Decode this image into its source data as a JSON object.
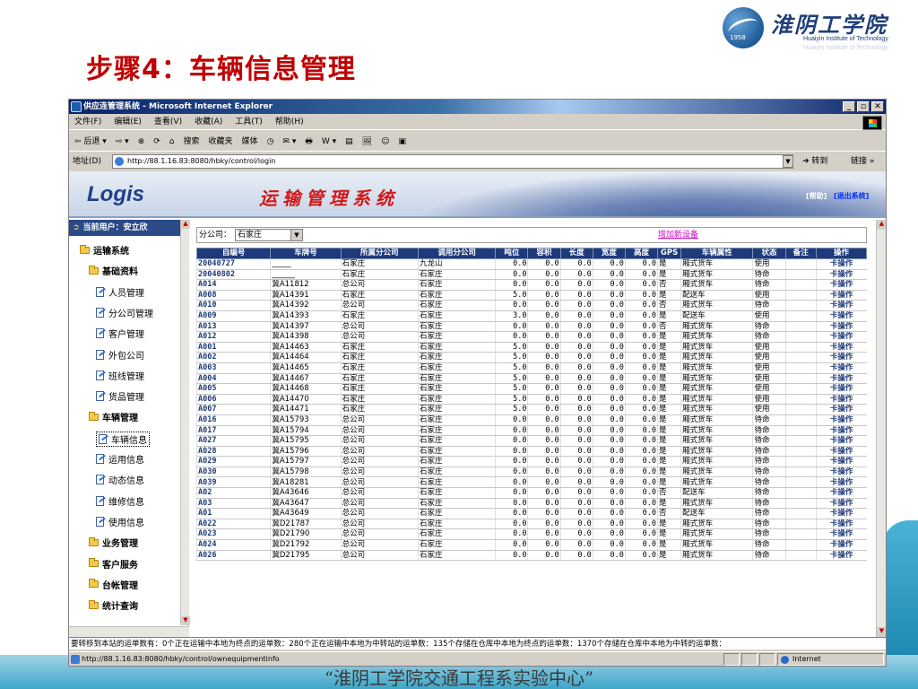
{
  "slide": {
    "title": "步骤4：车辆信息管理",
    "footer": "“淮阴工学院交通工程系实验中心”",
    "logo": {
      "cn": "淮阴工学院",
      "en": "Huaiyin Institute of Technology",
      "en_faded": "Huaiyin Institute of Technology",
      "year": "1958"
    }
  },
  "browser": {
    "title": "供应连管理系统 - Microsoft Internet Explorer",
    "menu": [
      "文件(F)",
      "编辑(E)",
      "查看(V)",
      "收藏(A)",
      "工具(T)",
      "帮助(H)"
    ],
    "toolbar": [
      "⇦ 后退 ▾",
      "⇨ ▾",
      "⊗",
      "⟳",
      "⌂",
      "搜索",
      "收藏夹",
      "媒体",
      "◷",
      "✉ ▾",
      "🖶",
      "W ▾",
      "▤",
      "🖼",
      "☺",
      "▣"
    ],
    "address_label": "地址(D)",
    "address": "http://88.1.16.83:8080/hbky/control/login",
    "go": "转到",
    "links": "链接 »",
    "status_url": "http://88.1.16.83:8080/hbky/control/ownequipmentinfo",
    "zone": "Internet"
  },
  "app": {
    "logo": "Logis",
    "title": "运输管理系统",
    "help": "[帮助]",
    "logout": "[退出系统]",
    "current_user": "当前用户：安立欣",
    "tree": [
      {
        "label": "运输系统",
        "type": "folder",
        "level": 0
      },
      {
        "label": "基础资料",
        "type": "folder",
        "level": 1
      },
      {
        "label": "人员管理",
        "type": "doc",
        "level": 2
      },
      {
        "label": "分公司管理",
        "type": "doc",
        "level": 2
      },
      {
        "label": "客户管理",
        "type": "doc",
        "level": 2
      },
      {
        "label": "外包公司",
        "type": "doc",
        "level": 2
      },
      {
        "label": "班线管理",
        "type": "doc",
        "level": 2
      },
      {
        "label": "货品管理",
        "type": "doc",
        "level": 2
      },
      {
        "label": "车辆管理",
        "type": "folder",
        "level": 1
      },
      {
        "label": "车辆信息",
        "type": "doc",
        "level": 2,
        "selected": true
      },
      {
        "label": "运用信息",
        "type": "doc",
        "level": 2
      },
      {
        "label": "动态信息",
        "type": "doc",
        "level": 2
      },
      {
        "label": "维修信息",
        "type": "doc",
        "level": 2
      },
      {
        "label": "使用信息",
        "type": "doc",
        "level": 2
      },
      {
        "label": "业务管理",
        "type": "folder",
        "level": 1
      },
      {
        "label": "客户服务",
        "type": "folder",
        "level": 1
      },
      {
        "label": "台帐管理",
        "type": "folder",
        "level": 1
      },
      {
        "label": "统计查询",
        "type": "folder",
        "level": 1
      }
    ],
    "filter_label": "分公司：",
    "filter_value": "石家庄",
    "add_link": "增加新设备",
    "columns": [
      "自编号",
      "车牌号",
      "所属分公司",
      "调用分公司",
      "吨位",
      "容积",
      "长度",
      "宽度",
      "高度",
      "GPS",
      "车辆属性",
      "状态",
      "备注",
      "操作"
    ],
    "rows": [
      [
        "20040727",
        "_____",
        "石家庄",
        "九龙山",
        "0.0",
        "0.0",
        "0.0",
        "0.0",
        "0.0",
        "是",
        "厢式货车",
        "使用",
        "",
        "卡操作"
      ],
      [
        "20040802",
        "______",
        "石家庄",
        "石家庄",
        "0.0",
        "0.0",
        "0.0",
        "0.0",
        "0.0",
        "是",
        "厢式货车",
        "待命",
        "",
        "卡操作"
      ],
      [
        "A014",
        "冀A11812",
        "总公司",
        "石家庄",
        "0.0",
        "0.0",
        "0.0",
        "0.0",
        "0.0",
        "否",
        "厢式货车",
        "待命",
        "",
        "卡操作"
      ],
      [
        "A008",
        "冀A14391",
        "石家庄",
        "石家庄",
        "5.0",
        "0.0",
        "0.0",
        "0.0",
        "0.0",
        "是",
        "配送车",
        "使用",
        "",
        "卡操作"
      ],
      [
        "A010",
        "冀A14392",
        "总公司",
        "石家庄",
        "0.0",
        "0.0",
        "0.0",
        "0.0",
        "0.0",
        "否",
        "厢式货车",
        "待命",
        "",
        "卡操作"
      ],
      [
        "A009",
        "冀A14393",
        "石家庄",
        "石家庄",
        "3.0",
        "0.0",
        "0.0",
        "0.0",
        "0.0",
        "是",
        "配送车",
        "使用",
        "",
        "卡操作"
      ],
      [
        "A013",
        "冀A14397",
        "总公司",
        "石家庄",
        "0.0",
        "0.0",
        "0.0",
        "0.0",
        "0.0",
        "否",
        "厢式货车",
        "待命",
        "",
        "卡操作"
      ],
      [
        "A012",
        "冀A14398",
        "总公司",
        "石家庄",
        "0.0",
        "0.0",
        "0.0",
        "0.0",
        "0.0",
        "是",
        "厢式货车",
        "待命",
        "",
        "卡操作"
      ],
      [
        "A001",
        "冀A14463",
        "石家庄",
        "石家庄",
        "5.0",
        "0.0",
        "0.0",
        "0.0",
        "0.0",
        "是",
        "厢式货车",
        "使用",
        "",
        "卡操作"
      ],
      [
        "A002",
        "冀A14464",
        "石家庄",
        "石家庄",
        "5.0",
        "0.0",
        "0.0",
        "0.0",
        "0.0",
        "是",
        "厢式货车",
        "使用",
        "",
        "卡操作"
      ],
      [
        "A003",
        "冀A14465",
        "石家庄",
        "石家庄",
        "5.0",
        "0.0",
        "0.0",
        "0.0",
        "0.0",
        "是",
        "厢式货车",
        "使用",
        "",
        "卡操作"
      ],
      [
        "A004",
        "冀A14467",
        "石家庄",
        "石家庄",
        "5.0",
        "0.0",
        "0.0",
        "0.0",
        "0.0",
        "是",
        "厢式货车",
        "使用",
        "",
        "卡操作"
      ],
      [
        "A005",
        "冀A14468",
        "石家庄",
        "石家庄",
        "5.0",
        "0.0",
        "0.0",
        "0.0",
        "0.0",
        "是",
        "厢式货车",
        "使用",
        "",
        "卡操作"
      ],
      [
        "A006",
        "冀A14470",
        "石家庄",
        "石家庄",
        "5.0",
        "0.0",
        "0.0",
        "0.0",
        "0.0",
        "是",
        "厢式货车",
        "使用",
        "",
        "卡操作"
      ],
      [
        "A007",
        "冀A14471",
        "石家庄",
        "石家庄",
        "5.0",
        "0.0",
        "0.0",
        "0.0",
        "0.0",
        "是",
        "厢式货车",
        "使用",
        "",
        "卡操作"
      ],
      [
        "A016",
        "冀A15793",
        "总公司",
        "石家庄",
        "0.0",
        "0.0",
        "0.0",
        "0.0",
        "0.0",
        "是",
        "厢式货车",
        "待命",
        "",
        "卡操作"
      ],
      [
        "A017",
        "冀A15794",
        "总公司",
        "石家庄",
        "0.0",
        "0.0",
        "0.0",
        "0.0",
        "0.0",
        "是",
        "厢式货车",
        "待命",
        "",
        "卡操作"
      ],
      [
        "A027",
        "冀A15795",
        "总公司",
        "石家庄",
        "0.0",
        "0.0",
        "0.0",
        "0.0",
        "0.0",
        "是",
        "厢式货车",
        "待命",
        "",
        "卡操作"
      ],
      [
        "A028",
        "冀A15796",
        "总公司",
        "石家庄",
        "0.0",
        "0.0",
        "0.0",
        "0.0",
        "0.0",
        "是",
        "厢式货车",
        "待命",
        "",
        "卡操作"
      ],
      [
        "A029",
        "冀A15797",
        "总公司",
        "石家庄",
        "0.0",
        "0.0",
        "0.0",
        "0.0",
        "0.0",
        "是",
        "厢式货车",
        "待命",
        "",
        "卡操作"
      ],
      [
        "A030",
        "冀A15798",
        "总公司",
        "石家庄",
        "0.0",
        "0.0",
        "0.0",
        "0.0",
        "0.0",
        "是",
        "厢式货车",
        "待命",
        "",
        "卡操作"
      ],
      [
        "A039",
        "冀A18281",
        "总公司",
        "石家庄",
        "0.0",
        "0.0",
        "0.0",
        "0.0",
        "0.0",
        "是",
        "厢式货车",
        "待命",
        "",
        "卡操作"
      ],
      [
        "A02",
        "冀A43646",
        "总公司",
        "石家庄",
        "0.0",
        "0.0",
        "0.0",
        "0.0",
        "0.0",
        "否",
        "配送车",
        "待命",
        "",
        "卡操作"
      ],
      [
        "A03",
        "冀A43647",
        "总公司",
        "石家庄",
        "0.0",
        "0.0",
        "0.0",
        "0.0",
        "0.0",
        "是",
        "厢式货车",
        "待命",
        "",
        "卡操作"
      ],
      [
        "A01",
        "冀A43649",
        "总公司",
        "石家庄",
        "0.0",
        "0.0",
        "0.0",
        "0.0",
        "0.0",
        "否",
        "配送车",
        "待命",
        "",
        "卡操作"
      ],
      [
        "A022",
        "冀D21787",
        "总公司",
        "石家庄",
        "0.0",
        "0.0",
        "0.0",
        "0.0",
        "0.0",
        "是",
        "厢式货车",
        "待命",
        "",
        "卡操作"
      ],
      [
        "A023",
        "冀D21790",
        "总公司",
        "石家庄",
        "0.0",
        "0.0",
        "0.0",
        "0.0",
        "0.0",
        "是",
        "厢式货车",
        "待命",
        "",
        "卡操作"
      ],
      [
        "A024",
        "冀D21792",
        "总公司",
        "石家庄",
        "0.0",
        "0.0",
        "0.0",
        "0.0",
        "0.0",
        "是",
        "厢式货车",
        "待命",
        "",
        "卡操作"
      ],
      [
        "A026",
        "冀D21795",
        "总公司",
        "石家庄",
        "0.0",
        "0.0",
        "0.0",
        "0.0",
        "0.0",
        "是",
        "厢式货车",
        "待命",
        "",
        "卡操作"
      ]
    ],
    "status_line": "要转移到本站的运单数有：0个正在运输中本地为终点的运单数：280个正在运输中本地为中转站的运单数：135个存储在仓库中本地为终点的运单数：1370个存储在仓库中本地为中转的运单数："
  },
  "colors": {
    "title_red": "#c00000",
    "header_navy": "#1e3a7a",
    "link_magenta": "#d000d0",
    "band_teal": "#3ea6c9"
  }
}
